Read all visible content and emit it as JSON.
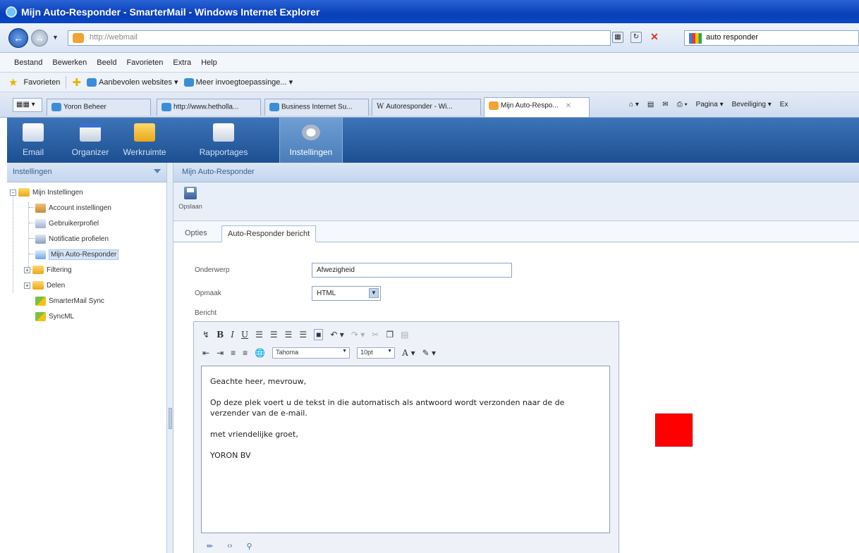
{
  "window": {
    "title": "Mijn Auto-Responder - SmarterMail - Windows Internet Explorer"
  },
  "address": {
    "url": "http://webmail",
    "search_value": "auto responder"
  },
  "menu": [
    "Bestand",
    "Bewerken",
    "Beeld",
    "Favorieten",
    "Extra",
    "Help"
  ],
  "favorites": {
    "label": "Favorieten",
    "items": [
      "Aanbevolen websites ▾",
      "Meer invoegtoepassinge... ▾"
    ]
  },
  "tabs": [
    "Yoron Beheer",
    "http://www.hetholla...",
    "Business Internet Su...",
    "Autoresponder - Wi...",
    "Mijn Auto-Respo..."
  ],
  "ie_commands": [
    "Pagina ▾",
    "Beveiliging ▾",
    "Ex"
  ],
  "appnav": [
    "Email",
    "Organizer",
    "Werkruimte",
    "Rapportages",
    "Instellingen"
  ],
  "sidebar": {
    "title": "Instellingen",
    "tree": {
      "root": "Mijn Instellingen",
      "children": [
        "Account instellingen",
        "Gebruikerprofiel",
        "Notificatie profielen",
        "Mijn Auto-Responder"
      ],
      "filtering": "Filtering",
      "delen": "Delen",
      "sync1": "SmarterMail Sync",
      "sync2": "SyncML"
    }
  },
  "main": {
    "title": "Mijn Auto-Responder",
    "save_label": "Opslaan",
    "tabs": [
      "Opties",
      "Auto-Responder bericht"
    ],
    "form": {
      "subject_label": "Onderwerp",
      "subject_value": "Afwezigheid",
      "format_label": "Opmaak",
      "format_value": "HTML",
      "message_label": "Bericht"
    },
    "editor": {
      "font": "Tahoma",
      "size": "10pt",
      "paragraphs": [
        "Geachte heer, mevrouw,",
        "Op deze plek voert u de tekst in die automatisch als antwoord wordt verzonden naar de de verzender van de e-mail.",
        "met vriendelijke groet,",
        "YORON BV"
      ]
    }
  },
  "colors": {
    "marker": "#ff0000",
    "header": "#1c4f91",
    "accent": "#3d74b8"
  }
}
